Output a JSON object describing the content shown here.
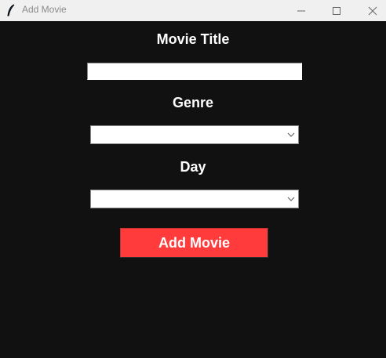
{
  "window": {
    "title": "Add Movie",
    "icon": "feather-icon"
  },
  "form": {
    "title_label": "Movie Title",
    "title_value": "",
    "genre_label": "Genre",
    "genre_value": "",
    "day_label": "Day",
    "day_value": "",
    "submit_label": "Add Movie"
  },
  "colors": {
    "background": "#111111",
    "button": "#ff3b3b",
    "titlebar": "#f0f0f0"
  }
}
